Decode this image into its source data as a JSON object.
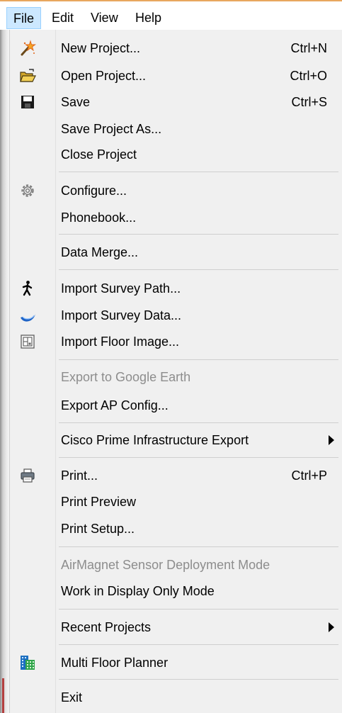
{
  "menubar": {
    "items": [
      "File",
      "Edit",
      "View",
      "Help"
    ]
  },
  "file_menu": {
    "items": [
      {
        "label": "New Project...",
        "shortcut": "Ctrl+N",
        "icon": "new-project-wand-icon"
      },
      {
        "label": "Open Project...",
        "shortcut": "Ctrl+O",
        "icon": "open-folder-icon"
      },
      {
        "label": "Save",
        "shortcut": "Ctrl+S",
        "icon": "floppy-disk-icon"
      },
      {
        "label": "Save Project As..."
      },
      {
        "label": "Close Project"
      },
      {
        "label": "Configure...",
        "icon": "gear-icon"
      },
      {
        "label": "Phonebook..."
      },
      {
        "label": "Data Merge..."
      },
      {
        "label": "Import Survey Path...",
        "icon": "walking-person-icon"
      },
      {
        "label": "Import Survey Data...",
        "icon": "survey-wave-icon"
      },
      {
        "label": "Import Floor Image...",
        "icon": "floor-image-icon"
      },
      {
        "label": "Export to Google Earth",
        "disabled": true
      },
      {
        "label": "Export AP Config..."
      },
      {
        "label": "Cisco Prime Infrastructure Export",
        "submenu": true
      },
      {
        "label": "Print...",
        "shortcut": "Ctrl+P",
        "icon": "printer-icon"
      },
      {
        "label": "Print Preview"
      },
      {
        "label": "Print Setup..."
      },
      {
        "label": "AirMagnet Sensor Deployment Mode",
        "disabled": true
      },
      {
        "label": "Work in Display Only  Mode"
      },
      {
        "label": "Recent Projects",
        "submenu": true
      },
      {
        "label": "Multi Floor Planner",
        "icon": "multi-floor-building-icon"
      },
      {
        "label": "Exit"
      }
    ]
  }
}
